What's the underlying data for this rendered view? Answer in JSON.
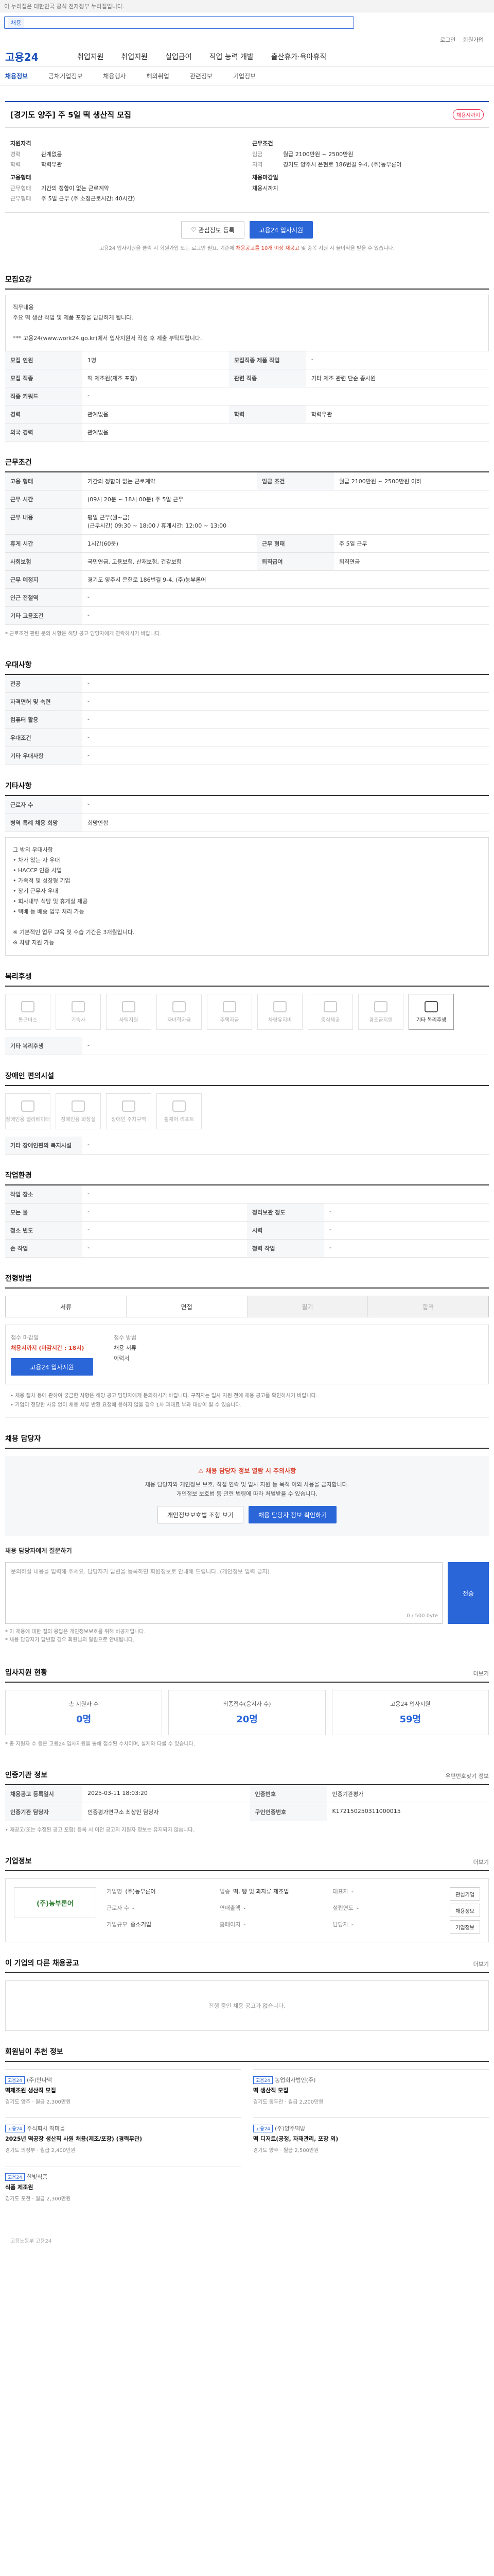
{
  "topbar": {
    "notice": "이 누리집은 대한민국 공식 전자정부 누리집입니다."
  },
  "search": {
    "scope": "채용",
    "placeholder": ""
  },
  "util": {
    "login": "로그인",
    "join": "회원가입"
  },
  "brand": {
    "logo": "고용24"
  },
  "gnb": [
    "취업지원",
    "취업지원",
    "실업급여",
    "직업 능력 개발",
    "출산휴가·육아휴직"
  ],
  "lnb": [
    "채용정보",
    "공채기업정보",
    "채용행사",
    "해외취업",
    "관련정보",
    "기업정보"
  ],
  "job": {
    "title": "[경기도 양주] 주 5일 떡 생산직 모집",
    "status": "채용시까지",
    "summary_left_cap": "지원자격",
    "summary_left": [
      {
        "k": "경력",
        "v": "관계없음"
      },
      {
        "k": "학력",
        "v": "학력무관"
      }
    ],
    "summary_left2_cap": "고용형태",
    "summary_left2": [
      {
        "k": "근무형태",
        "v": "기간의 정함이 없는 근로계약"
      },
      {
        "k": "근무형태",
        "v": "주 5일 근무 (주 소정근로시간: 40시간)"
      }
    ],
    "summary_right_cap": "근무조건",
    "summary_right": [
      {
        "k": "임금",
        "v": "월급 2100만원 ~ 2500만원"
      },
      {
        "k": "지역",
        "v": "경기도 양주시 은현로 186번길 9-4, (주)농부론어"
      }
    ],
    "summary_right2_cap": "채용마감일",
    "summary_right2": [
      {
        "k": "",
        "v": "채용시까지"
      }
    ],
    "interest_btn": "관심정보 등록",
    "apply_btn": "고용24 입사지원",
    "apply_note_a": "고용24 입사지원을 클릭 시 회원가입 또는 로그인 필요. 기존에 ",
    "apply_note_em": "채용공고를 10개 이상 재공고",
    "apply_note_b": " 및 중복 지원 시 불이익을 받을 수 있습니다."
  },
  "recruit": {
    "title": "모집요강",
    "desc": "직무내용\n주요 떡 생산 작업 및 제품 포장을 담당하게 됩니다.\n\n*** 고용24(www.work24.go.kr)에서 입사지원서 작성 후 제출 부탁드립니다.",
    "rows": [
      {
        "k": "모집 인원",
        "v": "1명",
        "k2": "모집직종 제품 작업",
        "v2": "-"
      },
      {
        "k": "모집 직종",
        "v": "떡 제조원(제조 포장)",
        "k2": "관련 직종",
        "v2": "기타 제조 관련 단순 종사원"
      },
      {
        "k": "직종 키워드",
        "v": "-",
        "k2": "",
        "v2": ""
      },
      {
        "k": "경력",
        "v": "관계없음",
        "k2": "학력",
        "v2": "학력무관"
      },
      {
        "k": "외국 경력",
        "v": "관계없음",
        "k2": "",
        "v2": ""
      }
    ]
  },
  "conditions": {
    "title": "근무조건",
    "rows": [
      {
        "k": "고용 형태",
        "v": "기간의 정함이 없는 근로계약",
        "k2": "임금 조건",
        "v2": "월급 2100만원 ~ 2500만원 이하"
      },
      {
        "k": "근무 시간",
        "v": "(09시 20분 ~ 18시 00분) 주 5일 근무",
        "k2": "",
        "v2": ""
      },
      {
        "k": "근무 내용",
        "v": "평일 근무(월~금)\n(근무시간) 09:30 ~ 18:00 / 휴게시간: 12:00 ~ 13:00",
        "k2": "",
        "v2": ""
      },
      {
        "k": "휴게 시간",
        "v": "1시간(60분)",
        "k2": "근무 형태",
        "v2": "주 5일 근무"
      },
      {
        "k": "사회보험",
        "v": "국민연금, 고용보험, 산재보험, 건강보험",
        "k2": "퇴직급여",
        "v2": "퇴직연금"
      },
      {
        "k": "근무 예정지",
        "v": "경기도 양주시 은현로 186번길 9-4, (주)농부론어",
        "k2": "",
        "v2": ""
      },
      {
        "k": "인근 전철역",
        "v": "-",
        "k2": "",
        "v2": ""
      },
      {
        "k": "기타 고용조건",
        "v": "-",
        "k2": "",
        "v2": ""
      }
    ],
    "note": "* 근로조건 관련 문의 사항은 해당 공고 담당자에게 연락하시기 바랍니다."
  },
  "preference": {
    "title": "우대사항",
    "rows": [
      {
        "k": "전공",
        "v": "-"
      },
      {
        "k": "자격면허 및 숙련",
        "v": "-"
      },
      {
        "k": "컴퓨터 활용",
        "v": "-"
      },
      {
        "k": "우대조건",
        "v": "-"
      },
      {
        "k": "기타 우대사항",
        "v": "-"
      }
    ]
  },
  "other": {
    "title": "기타사항",
    "rows": [
      {
        "k": "근로자 수",
        "v": "-"
      },
      {
        "k": "병역 특례 채용 희망",
        "v": "희망안함"
      }
    ],
    "desc": "그 밖의 우대사항\n• 차가 있는 자 우대\n• HACCP 인증 사업\n• 가족적 및 성장형 기업\n• 장기 근무자 우대\n• 회사내부 식당 및 휴게실 제공\n• 택배 등 배송 업무 처리 가능\n\n※ 기본적인 업무 교육 및 수습 기간은 3개월입니다.\n※ 차량 지원 가능"
  },
  "welfare": {
    "title": "복리후생",
    "items": [
      {
        "name": "통근버스",
        "on": false
      },
      {
        "name": "기숙사",
        "on": false
      },
      {
        "name": "사택지원",
        "on": false
      },
      {
        "name": "자녀학자금",
        "on": false
      },
      {
        "name": "주택자금",
        "on": false
      },
      {
        "name": "차량유지비",
        "on": false
      },
      {
        "name": "중식제공",
        "on": false
      },
      {
        "name": "경조금지원",
        "on": false
      },
      {
        "name": "기타 복리후생",
        "on": true
      }
    ],
    "extra_label": "기타 복리후생",
    "extra_value": "-"
  },
  "disability": {
    "title": "장애인 편의시설",
    "items": [
      {
        "name": "장애인용 엘리베이터",
        "on": false
      },
      {
        "name": "장애인용 화장실",
        "on": false
      },
      {
        "name": "장애인 주차구역",
        "on": false
      },
      {
        "name": "휠체어 리프트",
        "on": false
      }
    ],
    "extra_label": "기타 장애인편의 복지시설",
    "extra_value": "-"
  },
  "workplace": {
    "title": "작업환경",
    "rows": [
      {
        "k": "작업 장소",
        "v": "-",
        "k2": "",
        "v2": ""
      },
      {
        "k": "모는 물",
        "v": "-",
        "k2": "정리보관 정도",
        "v2": "-"
      },
      {
        "k": "청소 빈도",
        "v": "-",
        "k2": "시력",
        "v2": "-"
      },
      {
        "k": "손 작업",
        "v": "-",
        "k2": "청력 작업",
        "v2": "-"
      }
    ]
  },
  "selection": {
    "title": "전형방법",
    "steps": [
      "서류",
      "면접",
      "필기",
      "합격"
    ],
    "apply_method_label": "접수 마감일",
    "apply_method": "채용시까지 (마감시간 : 18시)",
    "apply_method_label2": "접수 방법",
    "apply_method2": "채용 서류",
    "doc_value": "이력서",
    "apply_btn": "고용24 입사지원",
    "bullets": "• 채용 절차 등에 관하여 궁금한 사항은 해당 공고 담당자에게 문의하시기 바랍니다. 구직자는 입사 지원 전에 채용 공고를 확인하시기 바랍니다.\n• 기업이 정당한 사유 없이 채용 서류 반환 요청에 응하지 않을 경우 1차 과태료 부과 대상이 될 수 있습니다."
  },
  "contact": {
    "title": "채용 담당자",
    "warn": "채용 담당자 정보 열람 시 주의사항",
    "txt": "채용 담당자와 개인정보 보호, 직접 연락 및 입사 지원 등 목적 이외 사용을 금지합니다.\n개인정보 보호법 등 관련 법령에 따라 처벌받을 수 있습니다.",
    "btn1": "개인정보보호법 조항 보기",
    "btn2": "채용 담당자 정보 확인하기"
  },
  "qna": {
    "title": "채용 담당자에게 질문하기",
    "placeholder": "문의하실 내용을 입력해 주세요. 담당자가 답변을 등록하면 회원정보로 안내해 드립니다. (개인정보 입력 금지)",
    "count": "0 / 500 byte",
    "btn": "전송",
    "note1": "* 이 채용에 대한 질의 응답은 개인정보보호를 위해 비공개입니다.",
    "note2": "* 채용 담당자가 답변할 경우 회원님의 알림으로 안내됩니다."
  },
  "stats": {
    "title": "입사지원 현황",
    "more": "더보기",
    "cards": [
      {
        "label": "총 지원자 수",
        "value": "0명"
      },
      {
        "label": "최종접수(응시자 수)",
        "value": "20명"
      },
      {
        "label": "고용24 입사지원",
        "value": "59명"
      }
    ],
    "note": "* 총 지원자 수 등은 고용24 입사지원을 통해 접수된 수치이며, 실제와 다를 수 있습니다."
  },
  "info": {
    "title": "인증기관 정보",
    "more_btn": "우편번호찾기 정보",
    "rows": [
      {
        "k": "채용공고 등록일시",
        "v": "2025-03-11 18:03:20",
        "k2": "인증번호",
        "v2": "인증기관평가"
      },
      {
        "k": "인증기관 담당자",
        "v": "인증평가연구소 최상민 담당자",
        "k2": "구인인증번호",
        "v2": "K172150250311000015"
      }
    ],
    "note": "• 재공고(또는 수정된 공고 포함) 등록 시 이전 공고의 지원자 정보는 유지되지 않습니다."
  },
  "company": {
    "title": "기업정보",
    "more": "더보기",
    "logo": "(주)농부론어",
    "fields": [
      {
        "k": "기업명",
        "v": "(주)농부론어"
      },
      {
        "k": "업종",
        "v": "떡, 빵 및 과자류 제조업"
      },
      {
        "k": "대표자",
        "v": "-"
      },
      {
        "k": "근로자 수",
        "v": "-"
      },
      {
        "k": "연매출액",
        "v": "-"
      },
      {
        "k": "설립연도",
        "v": "-"
      },
      {
        "k": "기업규모",
        "v": "중소기업"
      },
      {
        "k": "홈페이지",
        "v": "-"
      },
      {
        "k": "담당자",
        "v": "-"
      }
    ],
    "btn1": "관심기업",
    "btn2": "채용정보",
    "btn3": "기업정보"
  },
  "others": {
    "title": "이 기업의 다른 채용공고",
    "more": "더보기",
    "empty": "진행 중인 채용 공고가 없습니다."
  },
  "reco": {
    "title": "회원님이 추천 정보",
    "items": [
      {
        "company": "(주)만나떡",
        "title": "떡제조원 생산직 모집",
        "meta": "경기도 양주 · 월급 2,300만원",
        "tag": "고용24"
      },
      {
        "company": "농업회사법인(주)",
        "title": "떡 생산직 모집",
        "meta": "경기도 동두천 · 월급 2,200만원",
        "tag": "고용24"
      },
      {
        "company": "주식회사 떡마을",
        "title": "2025년 떡공장 생산직 사원 채용(제조/포장) (경력무관)",
        "meta": "경기도 의정부 · 월급 2,400만원",
        "tag": "고용24"
      },
      {
        "company": "(주)양주떡방",
        "title": "떡 디저트(공정, 자재관리, 포장 외)",
        "meta": "경기도 양주 · 월급 2,500만원",
        "tag": "고용24"
      },
      {
        "company": "한빛식품",
        "title": "식품 제조원",
        "meta": "경기도 포천 · 월급 2,300만원",
        "tag": "고용24"
      }
    ]
  },
  "footer": {
    "text": "고용노동부 고용24"
  }
}
